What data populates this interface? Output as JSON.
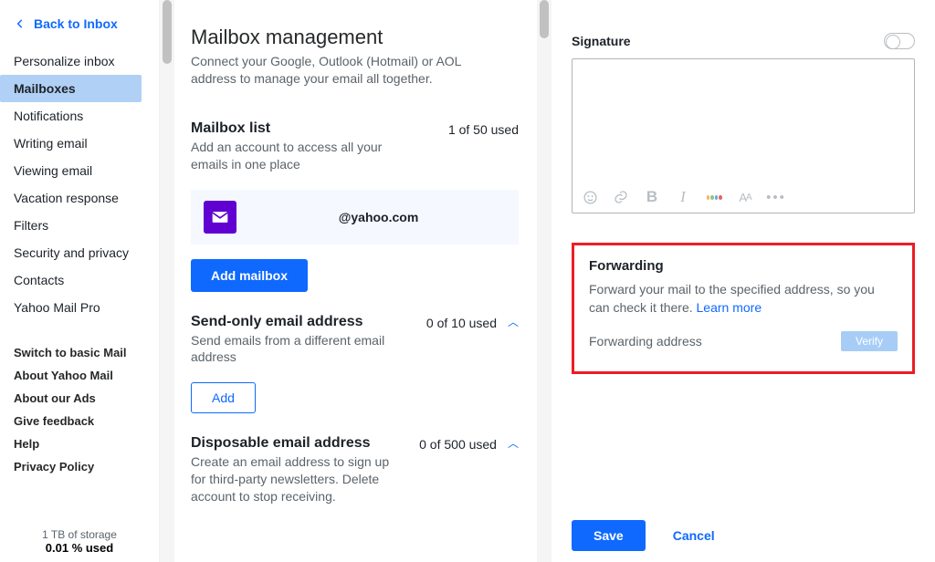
{
  "back_link": "Back to Inbox",
  "nav": {
    "items": [
      "Personalize inbox",
      "Mailboxes",
      "Notifications",
      "Writing email",
      "Viewing email",
      "Vacation response",
      "Filters",
      "Security and privacy",
      "Contacts",
      "Yahoo Mail Pro"
    ],
    "active_index": 1
  },
  "secondary_nav": [
    "Switch to basic Mail",
    "About Yahoo Mail",
    "About our Ads",
    "Give feedback",
    "Help",
    "Privacy Policy"
  ],
  "storage": {
    "line1": "1 TB of storage",
    "line2": "0.01 % used"
  },
  "page": {
    "title": "Mailbox management",
    "desc": "Connect your Google, Outlook (Hotmail) or AOL address to manage your email all together."
  },
  "mailbox_list": {
    "title": "Mailbox list",
    "desc": "Add an account to access all your emails in one place",
    "count": "1 of 50 used",
    "account_email": "@yahoo.com",
    "add_label": "Add mailbox"
  },
  "send_only": {
    "title": "Send-only email address",
    "desc": "Send emails from a different email address",
    "count": "0 of 10 used",
    "add_label": "Add"
  },
  "disposable": {
    "title": "Disposable email address",
    "desc": "Create an email address to sign up for third-party newsletters. Delete account to stop receiving.",
    "count": "0 of 500 used"
  },
  "signature": {
    "label": "Signature"
  },
  "forwarding": {
    "title": "Forwarding",
    "desc_prefix": "Forward your mail to the specified address, so you can check it there. ",
    "learn_more": "Learn more",
    "address_label": "Forwarding address",
    "verify_label": "Verify"
  },
  "actions": {
    "save": "Save",
    "cancel": "Cancel"
  }
}
